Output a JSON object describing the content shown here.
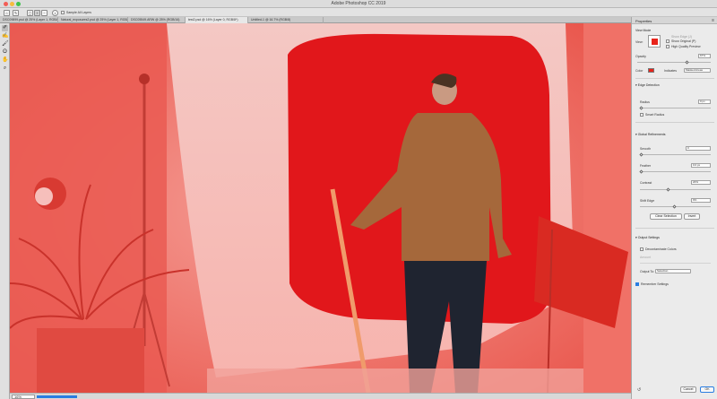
{
  "app": {
    "title": "Adobe Photoshop CC 2019"
  },
  "options_bar": {
    "sample_all_layers_label": "Sample All Layers"
  },
  "tabs": [
    {
      "label": "DSC09899.psd @ 25% (Layer 1, RGB/8*)"
    },
    {
      "label": "Natural_exposures2.psd @ 25% (Layer 1, RGB/8)"
    },
    {
      "label": "DSC05549.ARW @ 25% (RGB/16)"
    },
    {
      "label": "test2.psd @ 16% (Layer 0, RGB/8*)"
    },
    {
      "label": "Untitled-1 @ 16.7% (RGB/8)"
    }
  ],
  "active_tab_index": 3,
  "tools": [
    {
      "icon": "quick-selection-brush-icon"
    },
    {
      "icon": "refine-edge-brush-icon"
    },
    {
      "icon": "brush-icon"
    },
    {
      "icon": "lasso-icon"
    },
    {
      "icon": "hand-icon"
    },
    {
      "icon": "zoom-icon"
    }
  ],
  "status": {
    "zoom": "16%",
    "progress": 0.15
  },
  "properties": {
    "title": "Properties",
    "view_mode": {
      "label": "View Mode",
      "view_label": "View:",
      "show_edge": "Show Edge (J)",
      "show_original": "Show Original (P)",
      "high_quality_preview": "High Quality Preview"
    },
    "opacity": {
      "label": "Opacity",
      "value": "67%"
    },
    "color": {
      "label": "Color",
      "swatch": "#e8231a",
      "indicates_label": "Indicates",
      "indicates_value": "Masked Areas"
    },
    "edge_detection": {
      "header": "Edge Detection",
      "radius_label": "Radius",
      "radius_value": "0 px",
      "smart_radius": "Smart Radius"
    },
    "global_refinements": {
      "header": "Global Refinements",
      "smooth_label": "Smooth",
      "smooth_value": "0",
      "feather_label": "Feather",
      "feather_value": "0.0 px",
      "contrast_label": "Contrast",
      "contrast_value": "20%",
      "shift_edge_label": "Shift Edge",
      "shift_edge_value": "0%",
      "clear_selection": "Clear Selection",
      "invert": "Invert"
    },
    "output_settings": {
      "header": "Output Settings",
      "decontaminate": "Decontaminate Colors",
      "amount_label": "Amount",
      "output_to_label": "Output To:",
      "output_to_value": "Selection",
      "remember": "Remember Settings"
    },
    "cancel": "Cancel",
    "ok": "OK"
  },
  "colors": {
    "mask_red": "#e8231a",
    "accent_blue": "#2a7de1"
  }
}
